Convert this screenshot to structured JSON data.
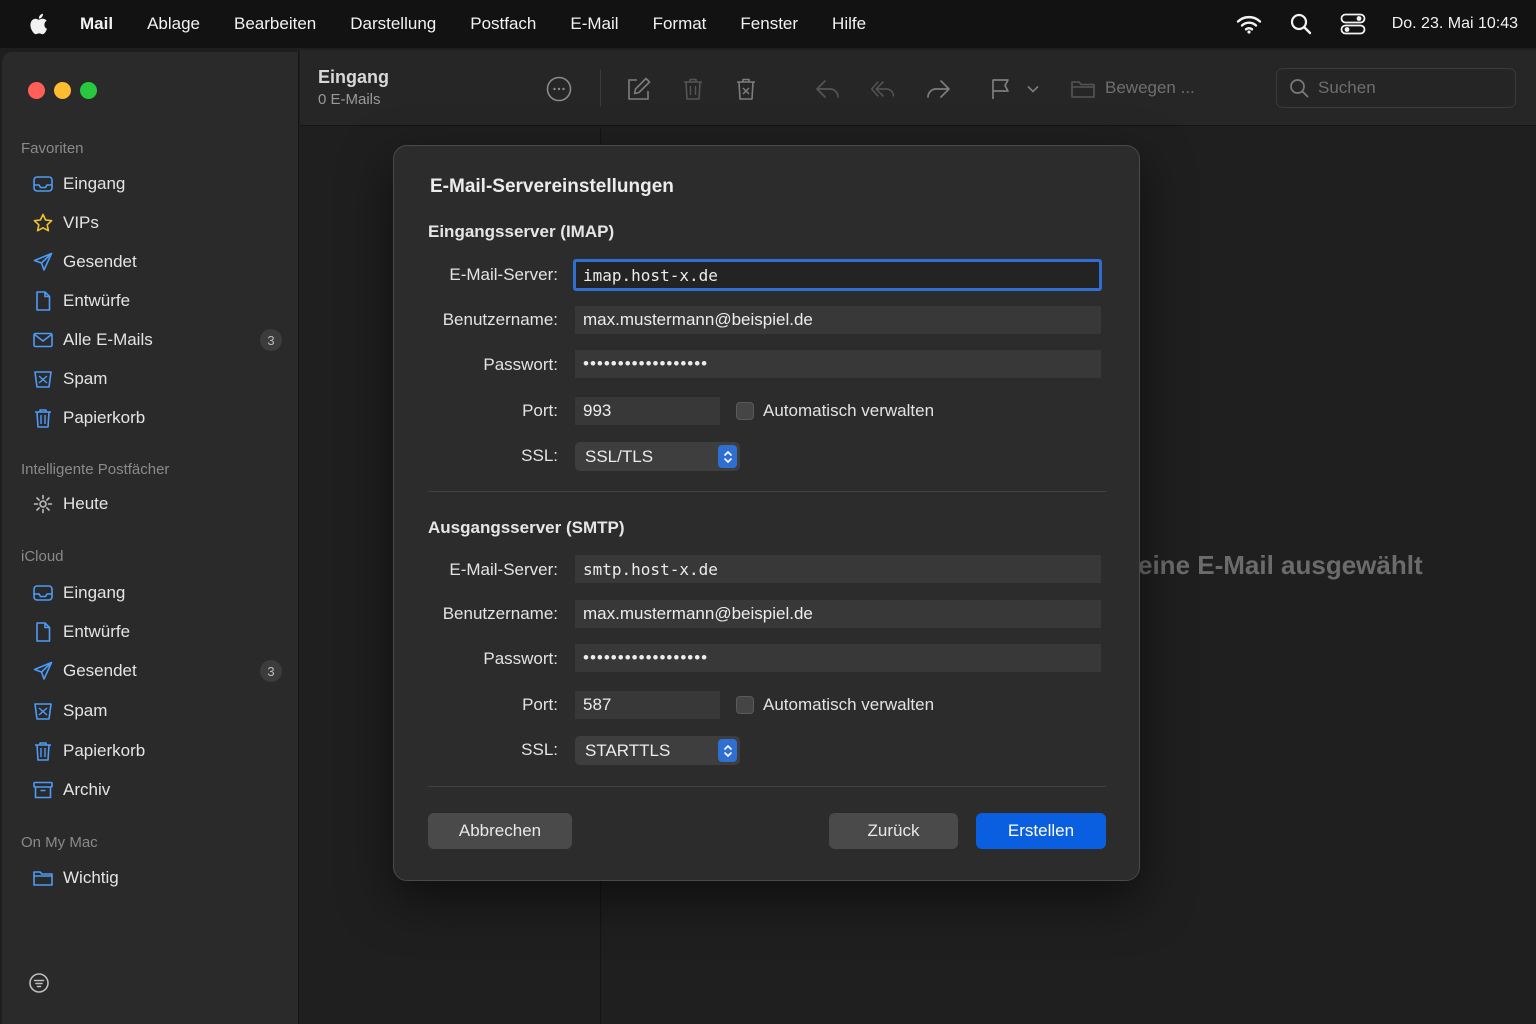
{
  "menubar": {
    "app_name": "Mail",
    "items": [
      "Ablage",
      "Bearbeiten",
      "Darstellung",
      "Postfach",
      "E-Mail",
      "Format",
      "Fenster",
      "Hilfe"
    ],
    "clock": "Do. 23. Mai  10:43"
  },
  "sidebar": {
    "favorites_title": "Favoriten",
    "favorites": [
      {
        "label": "Eingang",
        "icon": "inbox-icon"
      },
      {
        "label": "VIPs",
        "icon": "star-icon"
      },
      {
        "label": "Gesendet",
        "icon": "paperplane-icon"
      },
      {
        "label": "Entwürfe",
        "icon": "document-icon"
      },
      {
        "label": "Alle E-Mails",
        "icon": "envelope-icon",
        "badge": "3"
      },
      {
        "label": "Spam",
        "icon": "junk-icon"
      },
      {
        "label": "Papierkorb",
        "icon": "trash-icon"
      }
    ],
    "smart_title": "Intelligente Postfächer",
    "smart": [
      {
        "label": "Heute",
        "icon": "gear-icon"
      }
    ],
    "icloud_title": "iCloud",
    "icloud": [
      {
        "label": "Eingang",
        "icon": "inbox-icon"
      },
      {
        "label": "Entwürfe",
        "icon": "document-icon"
      },
      {
        "label": "Gesendet",
        "icon": "paperplane-icon",
        "badge": "3"
      },
      {
        "label": "Spam",
        "icon": "junk-icon"
      },
      {
        "label": "Papierkorb",
        "icon": "trash-icon"
      },
      {
        "label": "Archiv",
        "icon": "archive-icon"
      }
    ],
    "onmymac_title": "On My Mac",
    "onmymac": [
      {
        "label": "Wichtig",
        "icon": "folder-icon"
      }
    ]
  },
  "toolbar": {
    "title": "Eingang",
    "subtitle": "0 E-Mails",
    "move_label": "Bewegen ...",
    "search_placeholder": "Suchen"
  },
  "content": {
    "empty_text": "eine E-Mail ausgewählt"
  },
  "dialog": {
    "title": "E-Mail-Servereinstellungen",
    "incoming": {
      "section_title": "Eingangsserver (IMAP)",
      "server_label": "E-Mail-Server:",
      "server_value": "imap.host-x.de",
      "user_label": "Benutzername:",
      "user_value": "max.mustermann@beispiel.de",
      "password_label": "Passwort:",
      "password_value": "••••••••••••••••••",
      "port_label": "Port:",
      "port_value": "993",
      "auto_label": "Automatisch verwalten",
      "ssl_label": "SSL:",
      "ssl_value": "SSL/TLS"
    },
    "outgoing": {
      "section_title": "Ausgangsserver (SMTP)",
      "server_label": "E-Mail-Server:",
      "server_value": "smtp.host-x.de",
      "user_label": "Benutzername:",
      "user_value": "max.mustermann@beispiel.de",
      "password_label": "Passwort:",
      "password_value": "••••••••••••••••••",
      "port_label": "Port:",
      "port_value": "587",
      "auto_label": "Automatisch verwalten",
      "ssl_label": "SSL:",
      "ssl_value": "STARTTLS"
    },
    "buttons": {
      "cancel": "Abbrechen",
      "back": "Zurück",
      "create": "Erstellen"
    }
  },
  "colors": {
    "accent": "#0a5fe0",
    "focus_ring": "#2f6fd1",
    "traffic_red": "#ff5f57",
    "traffic_yellow": "#febc2e",
    "traffic_green": "#28c840",
    "sidebar_icon": "#4d9bf7",
    "vip_star": "#f0c232"
  }
}
